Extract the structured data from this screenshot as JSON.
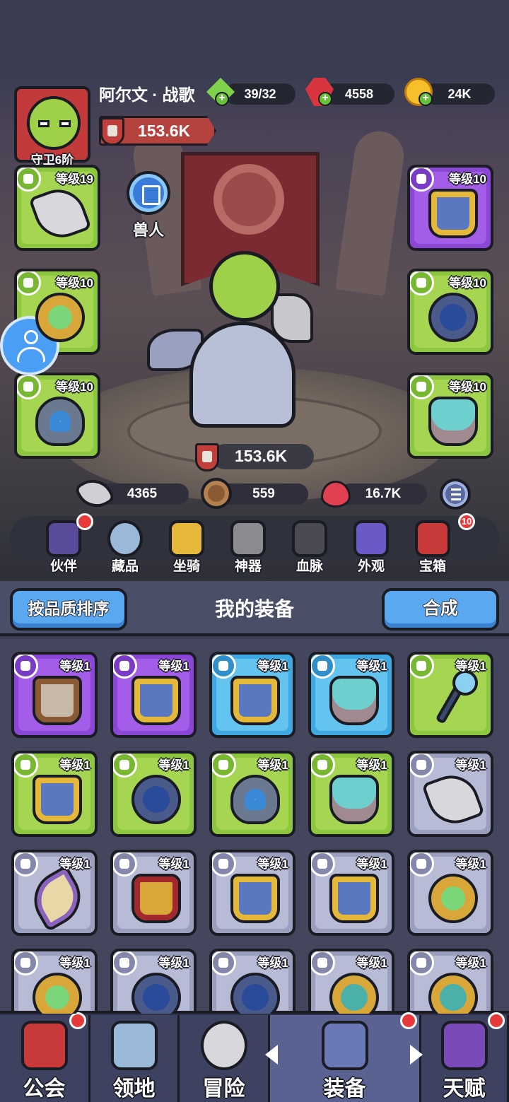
{
  "player": {
    "name": "阿尔文 · 战歌",
    "rank": "守卫6阶",
    "power": "153.6K",
    "race": "兽人"
  },
  "resources": {
    "energy": "39/32",
    "gems": "4558",
    "gold": "24K"
  },
  "equipped": {
    "left": [
      {
        "level": "等级19",
        "item": "axe-icon",
        "rarity": "green"
      },
      {
        "level": "等级10",
        "item": "ring-icon",
        "rarity": "green"
      },
      {
        "level": "等级10",
        "item": "amulet-icon",
        "rarity": "green"
      }
    ],
    "right": [
      {
        "level": "等级10",
        "item": "armor-icon",
        "rarity": "purple"
      },
      {
        "level": "等级10",
        "item": "ring-icon",
        "rarity": "green"
      },
      {
        "level": "等级10",
        "item": "mask-icon",
        "rarity": "green"
      }
    ]
  },
  "total_power": "153.6K",
  "stats": {
    "attack": "4365",
    "defense": "559",
    "hp": "16.7K"
  },
  "menu": [
    {
      "label": "伙伴",
      "icon": "companion-icon",
      "dot": ""
    },
    {
      "label": "藏品",
      "icon": "collection-icon",
      "dot": ""
    },
    {
      "label": "坐骑",
      "icon": "mount-icon",
      "dot": ""
    },
    {
      "label": "神器",
      "icon": "artifact-icon",
      "dot": ""
    },
    {
      "label": "血脉",
      "icon": "bloodline-icon",
      "dot": ""
    },
    {
      "label": "外观",
      "icon": "appearance-icon",
      "dot": ""
    },
    {
      "label": "宝箱",
      "icon": "chest-icon",
      "dot": "10"
    }
  ],
  "inventory_header": {
    "sort_label": "按品质排序",
    "title": "我的装备",
    "synth_label": "合成"
  },
  "inventory": [
    {
      "level": "等级1",
      "item": "tunic",
      "rarity": "purple"
    },
    {
      "level": "等级1",
      "item": "armor",
      "rarity": "purple"
    },
    {
      "level": "等级1",
      "item": "armor",
      "rarity": "blue"
    },
    {
      "level": "等级1",
      "item": "mask",
      "rarity": "blue"
    },
    {
      "level": "等级1",
      "item": "staff",
      "rarity": "green"
    },
    {
      "level": "等级1",
      "item": "armor",
      "rarity": "green"
    },
    {
      "level": "等级1",
      "item": "ring-blue",
      "rarity": "green"
    },
    {
      "level": "等级1",
      "item": "amulet",
      "rarity": "green"
    },
    {
      "level": "等级1",
      "item": "mask",
      "rarity": "green"
    },
    {
      "level": "等级1",
      "item": "axe",
      "rarity": "gray"
    },
    {
      "level": "等级1",
      "item": "horn",
      "rarity": "gray"
    },
    {
      "level": "等级1",
      "item": "armor-gold",
      "rarity": "gray"
    },
    {
      "level": "等级1",
      "item": "armor",
      "rarity": "gray"
    },
    {
      "level": "等级1",
      "item": "armor",
      "rarity": "gray"
    },
    {
      "level": "等级1",
      "item": "ring",
      "rarity": "gray"
    },
    {
      "level": "等级1",
      "item": "ring",
      "rarity": "gray"
    },
    {
      "level": "等级1",
      "item": "ring-blue",
      "rarity": "gray"
    },
    {
      "level": "等级1",
      "item": "ring-blue",
      "rarity": "gray"
    },
    {
      "level": "等级1",
      "item": "ring-gold",
      "rarity": "gray"
    },
    {
      "level": "等级1",
      "item": "ring-gold",
      "rarity": "gray"
    }
  ],
  "nav": [
    {
      "label": "公会",
      "icon": "guild-icon",
      "dot": true,
      "active": false
    },
    {
      "label": "领地",
      "icon": "castle-icon",
      "dot": false,
      "active": false
    },
    {
      "label": "冒险",
      "icon": "crossed-axes-icon",
      "dot": false,
      "active": false
    },
    {
      "label": "装备",
      "icon": "helmet-icon",
      "dot": true,
      "active": true
    },
    {
      "label": "天赋",
      "icon": "talent-book-icon",
      "dot": true,
      "active": false
    }
  ],
  "colors": {
    "rarity_green": "#8dc63f",
    "rarity_purple": "#8a47d6",
    "rarity_blue": "#3fa8e0",
    "rarity_gray": "#9a9fbe",
    "accent_button": "#5aa8f0",
    "notification": "#e63a3a"
  }
}
